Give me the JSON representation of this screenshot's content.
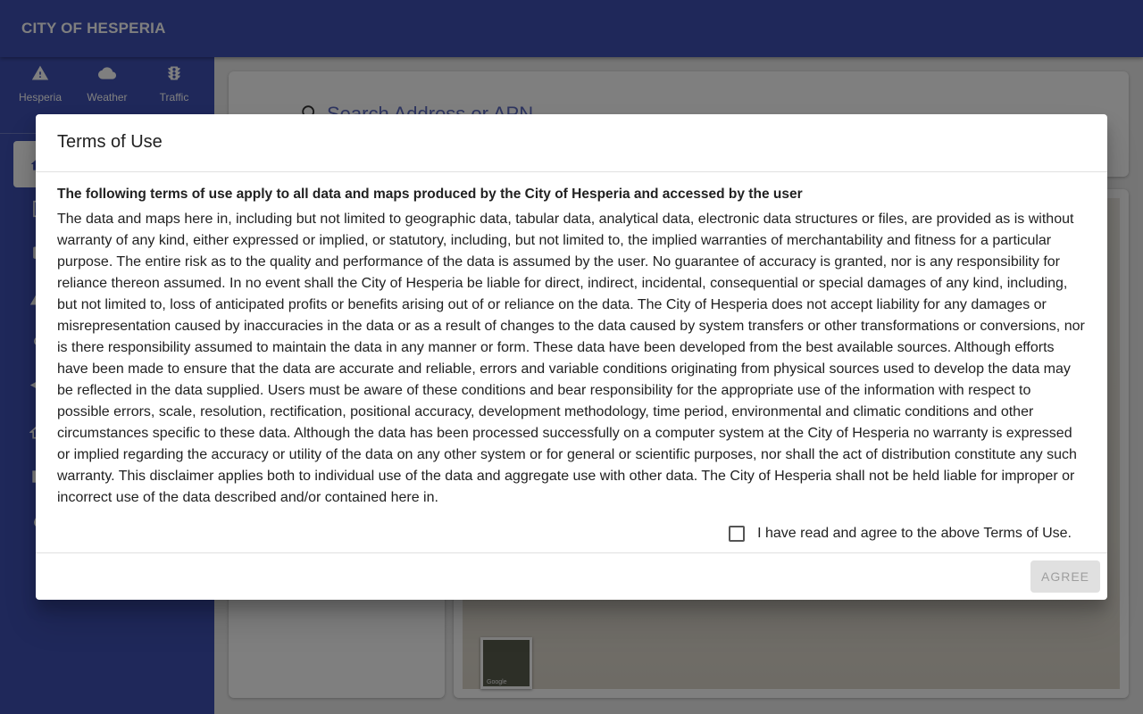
{
  "app": {
    "title": "CITY OF HESPERIA"
  },
  "quick_links": [
    {
      "label": "Hesperia",
      "icon": "warning-icon"
    },
    {
      "label": "Weather",
      "icon": "cloud-icon"
    },
    {
      "label": "Traffic",
      "icon": "traffic-light-icon"
    }
  ],
  "search": {
    "placeholder": "Search Address or APN"
  },
  "map": {
    "attribution": "Google"
  },
  "dialog": {
    "title": "Terms of Use",
    "heading": "The following terms of use apply to all data and maps produced by the City of Hesperia and accessed by the user",
    "body": "The data and maps here in, including but not limited to geographic data, tabular data, analytical data, electronic data structures or files, are provided as is without warranty of any kind, either expressed or implied, or statutory, including, but not limited to, the implied warranties of merchantability and fitness for a particular purpose. The entire risk as to the quality and performance of the data is assumed by the user. No guarantee of accuracy is granted, nor is any responsibility for reliance thereon assumed. In no event shall the City of Hesperia be liable for direct, indirect, incidental, consequential or special damages of any kind, including, but not limited to, loss of anticipated profits or benefits arising out of or reliance on the data. The City of Hesperia does not accept liability for any damages or misrepresentation caused by inaccuracies in the data or as a result of changes to the data caused by system transfers or other transformations or conversions, nor is there responsibility assumed to maintain the data in any manner or form. These data have been developed from the best available sources. Although efforts have been made to ensure that the data are accurate and reliable, errors and variable conditions originating from physical sources used to develop the data may be reflected in the data supplied. Users must be aware of these conditions and bear responsibility for the appropriate use of the information with respect to possible errors, scale, resolution, rectification, positional accuracy, development methodology, time period, environmental and climatic conditions and other circumstances specific to these data. Although the data has been processed successfully on a computer system at the City of Hesperia no warranty is expressed or implied regarding the accuracy or utility of the data on any other system or for general or scientific purposes, nor shall the act of distribution constitute any such warranty. This disclaimer applies both to individual use of the data and aggregate use with other data. The City of Hesperia shall not be held liable for improper or incorrect use of the data described and/or contained here in.",
    "checkbox_label": "I have read and agree to the above Terms of Use.",
    "checkbox_checked": false,
    "agree_button": "AGREE"
  },
  "colors": {
    "primary": "#3f51b5",
    "scrim": "rgba(0,0,0,0.5)",
    "button_disabled_bg": "#e0e0e0",
    "button_disabled_text": "#9e9e9e"
  }
}
